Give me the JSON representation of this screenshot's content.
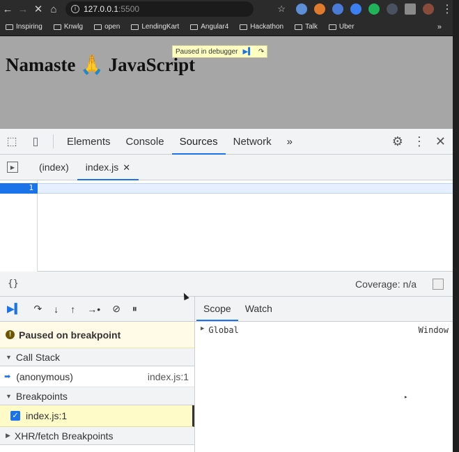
{
  "browser": {
    "url_host": "127.0.0.1",
    "url_port": ":5500",
    "bookmarks": [
      "Inspiring",
      "Knwlg",
      "open",
      "LendingKart",
      "Angular4",
      "Hackathon",
      "Talk",
      "Uber"
    ],
    "bookmarks_more": "»"
  },
  "page": {
    "heading": "Namaste 🙏 JavaScript",
    "paused_banner": "Paused in debugger"
  },
  "devtools": {
    "tabs": [
      "Elements",
      "Console",
      "Sources",
      "Network"
    ],
    "active_tab": "Sources",
    "more_tabs": "»",
    "file_tabs": [
      "(index)",
      "index.js"
    ],
    "active_file": "index.js",
    "line_number": "1",
    "pretty_print": "{}",
    "coverage": "Coverage: n/a",
    "paused_message": "Paused on breakpoint",
    "call_stack_header": "Call Stack",
    "call_frame": {
      "name": "(anonymous)",
      "location": "index.js:1"
    },
    "breakpoints_header": "Breakpoints",
    "breakpoint": "index.js:1",
    "xhr_header": "XHR/fetch Breakpoints",
    "scope_tabs": [
      "Scope",
      "Watch"
    ],
    "scope_global_label": "Global",
    "scope_global_value": "Window"
  },
  "colors": {
    "accent": "#1a73e8",
    "paused_bg": "#fffbe6",
    "breakpoint_bg": "#fffbc8",
    "viewport_bg": "#a6a6a6"
  }
}
